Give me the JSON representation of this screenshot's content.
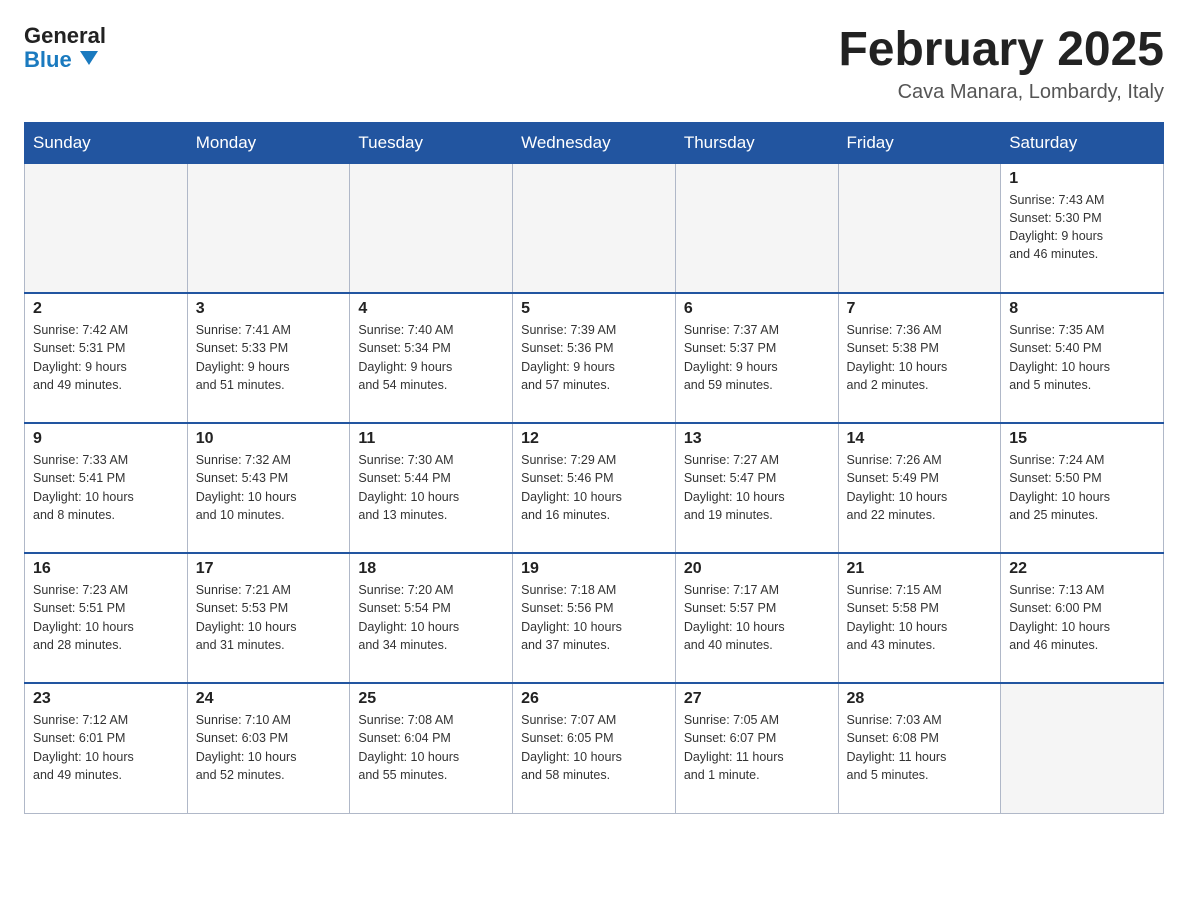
{
  "header": {
    "logo_line1": "General",
    "logo_line2": "Blue",
    "title": "February 2025",
    "location": "Cava Manara, Lombardy, Italy"
  },
  "weekdays": [
    "Sunday",
    "Monday",
    "Tuesday",
    "Wednesday",
    "Thursday",
    "Friday",
    "Saturday"
  ],
  "weeks": [
    [
      {
        "day": "",
        "info": ""
      },
      {
        "day": "",
        "info": ""
      },
      {
        "day": "",
        "info": ""
      },
      {
        "day": "",
        "info": ""
      },
      {
        "day": "",
        "info": ""
      },
      {
        "day": "",
        "info": ""
      },
      {
        "day": "1",
        "info": "Sunrise: 7:43 AM\nSunset: 5:30 PM\nDaylight: 9 hours\nand 46 minutes."
      }
    ],
    [
      {
        "day": "2",
        "info": "Sunrise: 7:42 AM\nSunset: 5:31 PM\nDaylight: 9 hours\nand 49 minutes."
      },
      {
        "day": "3",
        "info": "Sunrise: 7:41 AM\nSunset: 5:33 PM\nDaylight: 9 hours\nand 51 minutes."
      },
      {
        "day": "4",
        "info": "Sunrise: 7:40 AM\nSunset: 5:34 PM\nDaylight: 9 hours\nand 54 minutes."
      },
      {
        "day": "5",
        "info": "Sunrise: 7:39 AM\nSunset: 5:36 PM\nDaylight: 9 hours\nand 57 minutes."
      },
      {
        "day": "6",
        "info": "Sunrise: 7:37 AM\nSunset: 5:37 PM\nDaylight: 9 hours\nand 59 minutes."
      },
      {
        "day": "7",
        "info": "Sunrise: 7:36 AM\nSunset: 5:38 PM\nDaylight: 10 hours\nand 2 minutes."
      },
      {
        "day": "8",
        "info": "Sunrise: 7:35 AM\nSunset: 5:40 PM\nDaylight: 10 hours\nand 5 minutes."
      }
    ],
    [
      {
        "day": "9",
        "info": "Sunrise: 7:33 AM\nSunset: 5:41 PM\nDaylight: 10 hours\nand 8 minutes."
      },
      {
        "day": "10",
        "info": "Sunrise: 7:32 AM\nSunset: 5:43 PM\nDaylight: 10 hours\nand 10 minutes."
      },
      {
        "day": "11",
        "info": "Sunrise: 7:30 AM\nSunset: 5:44 PM\nDaylight: 10 hours\nand 13 minutes."
      },
      {
        "day": "12",
        "info": "Sunrise: 7:29 AM\nSunset: 5:46 PM\nDaylight: 10 hours\nand 16 minutes."
      },
      {
        "day": "13",
        "info": "Sunrise: 7:27 AM\nSunset: 5:47 PM\nDaylight: 10 hours\nand 19 minutes."
      },
      {
        "day": "14",
        "info": "Sunrise: 7:26 AM\nSunset: 5:49 PM\nDaylight: 10 hours\nand 22 minutes."
      },
      {
        "day": "15",
        "info": "Sunrise: 7:24 AM\nSunset: 5:50 PM\nDaylight: 10 hours\nand 25 minutes."
      }
    ],
    [
      {
        "day": "16",
        "info": "Sunrise: 7:23 AM\nSunset: 5:51 PM\nDaylight: 10 hours\nand 28 minutes."
      },
      {
        "day": "17",
        "info": "Sunrise: 7:21 AM\nSunset: 5:53 PM\nDaylight: 10 hours\nand 31 minutes."
      },
      {
        "day": "18",
        "info": "Sunrise: 7:20 AM\nSunset: 5:54 PM\nDaylight: 10 hours\nand 34 minutes."
      },
      {
        "day": "19",
        "info": "Sunrise: 7:18 AM\nSunset: 5:56 PM\nDaylight: 10 hours\nand 37 minutes."
      },
      {
        "day": "20",
        "info": "Sunrise: 7:17 AM\nSunset: 5:57 PM\nDaylight: 10 hours\nand 40 minutes."
      },
      {
        "day": "21",
        "info": "Sunrise: 7:15 AM\nSunset: 5:58 PM\nDaylight: 10 hours\nand 43 minutes."
      },
      {
        "day": "22",
        "info": "Sunrise: 7:13 AM\nSunset: 6:00 PM\nDaylight: 10 hours\nand 46 minutes."
      }
    ],
    [
      {
        "day": "23",
        "info": "Sunrise: 7:12 AM\nSunset: 6:01 PM\nDaylight: 10 hours\nand 49 minutes."
      },
      {
        "day": "24",
        "info": "Sunrise: 7:10 AM\nSunset: 6:03 PM\nDaylight: 10 hours\nand 52 minutes."
      },
      {
        "day": "25",
        "info": "Sunrise: 7:08 AM\nSunset: 6:04 PM\nDaylight: 10 hours\nand 55 minutes."
      },
      {
        "day": "26",
        "info": "Sunrise: 7:07 AM\nSunset: 6:05 PM\nDaylight: 10 hours\nand 58 minutes."
      },
      {
        "day": "27",
        "info": "Sunrise: 7:05 AM\nSunset: 6:07 PM\nDaylight: 11 hours\nand 1 minute."
      },
      {
        "day": "28",
        "info": "Sunrise: 7:03 AM\nSunset: 6:08 PM\nDaylight: 11 hours\nand 5 minutes."
      },
      {
        "day": "",
        "info": ""
      }
    ]
  ]
}
